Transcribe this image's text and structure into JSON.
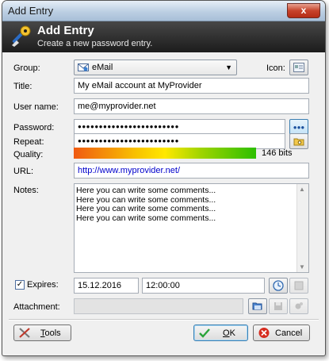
{
  "window": {
    "title": "Add Entry",
    "close_symbol": "x"
  },
  "banner": {
    "title": "Add Entry",
    "subtitle": "Create a new password entry.",
    "icon": "key-pen-icon"
  },
  "form": {
    "group": {
      "label": "Group:",
      "value": "eMail",
      "icon": "email-icon"
    },
    "icon_label": "Icon:",
    "title": {
      "label": "Title:",
      "value": "My eMail account at MyProvider"
    },
    "username": {
      "label": "User name:",
      "value": "me@myprovider.net"
    },
    "password": {
      "label": "Password:",
      "value": "●●●●●●●●●●●●●●●●●●●●●●●●"
    },
    "repeat": {
      "label": "Repeat:",
      "value": "●●●●●●●●●●●●●●●●●●●●●●●●"
    },
    "quality": {
      "label": "Quality:",
      "bits": "146 bits"
    },
    "url": {
      "label": "URL:",
      "value": "http://www.myprovider.net/"
    },
    "notes": {
      "label": "Notes:",
      "lines": [
        "Here you can write some comments...",
        "Here you can write some comments...",
        "Here you can write some comments...",
        "Here you can write some comments..."
      ]
    },
    "expires": {
      "label": "Expires:",
      "checked": true,
      "date": "15.12.2016",
      "time": "12:00:00"
    },
    "attachment": {
      "label": "Attachment:"
    },
    "show_password_symbol": "●●●"
  },
  "buttons": {
    "tools": {
      "prefix": "",
      "underline": "T",
      "rest": "ools"
    },
    "ok": {
      "underline": "O",
      "rest": "K"
    },
    "cancel": "Cancel"
  }
}
